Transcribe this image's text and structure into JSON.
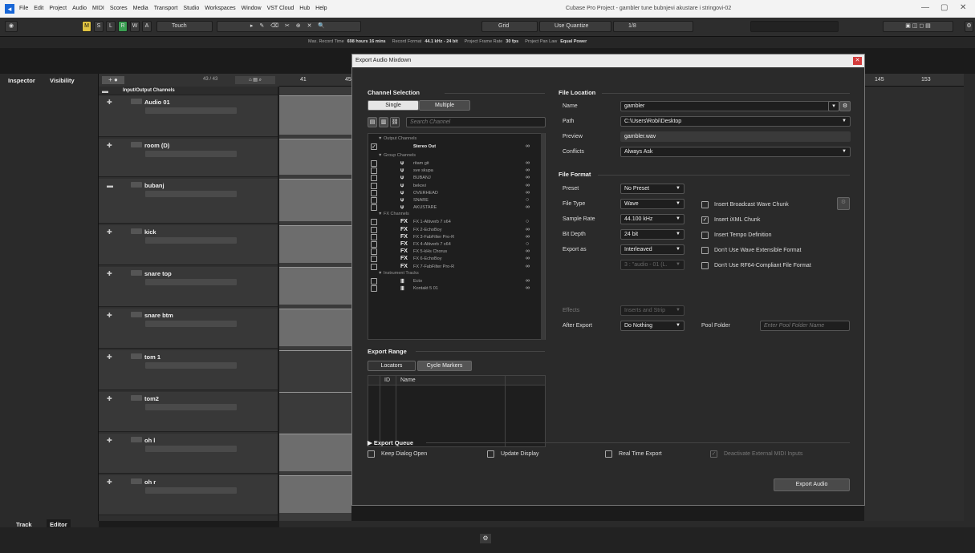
{
  "window": {
    "title": "Cubase Pro Project - gambler tune bubnjevi akustare i stringovi-02",
    "minimize": "—",
    "maximize": "▢",
    "close": "✕"
  },
  "menu": [
    "File",
    "Edit",
    "Project",
    "Audio",
    "MIDI",
    "Scores",
    "Media",
    "Transport",
    "Studio",
    "Workspaces",
    "Window",
    "VST Cloud",
    "Hub",
    "Help"
  ],
  "toolbar": {
    "mode_letters": [
      "M",
      "S",
      "L",
      "R",
      "W",
      "A"
    ],
    "automation_mode": "Touch",
    "grid_label": "Grid",
    "quantize_label": "Use Quantize",
    "quantize_value": "1/8"
  },
  "infobar": [
    {
      "label": "Max. Record Time",
      "value": "698 hours 16 mins"
    },
    {
      "label": "Record Format",
      "value": "44.1 kHz - 24 bit"
    },
    {
      "label": "Project Frame Rate",
      "value": "30 fps"
    },
    {
      "label": "Project Pan Law",
      "value": "Equal Power"
    }
  ],
  "left_tabs": {
    "inspector": "Inspector",
    "visibility": "Visibility",
    "track": "Track",
    "editor": "Editor"
  },
  "tracklist": {
    "counter": "43 / 43",
    "folder": "Input/Output Channels",
    "tracks": [
      "Audio 01",
      "room (D)",
      "bubanj",
      "kick",
      "snare top",
      "snare btm",
      "tom 1",
      "tom2",
      "oh l",
      "oh r"
    ]
  },
  "ruler": {
    "left_marks": [
      "41",
      "45"
    ],
    "right_marks": [
      "145",
      "153"
    ]
  },
  "dialog": {
    "title": "Export Audio Mixdown",
    "channel_selection": {
      "heading": "Channel Selection",
      "tabs": [
        "Single",
        "Multiple"
      ],
      "search_placeholder": "Search Channel",
      "groups": [
        {
          "name": "Output Channels",
          "channels": [
            {
              "name": "Stereo Out",
              "checked": true,
              "type": "∞"
            }
          ]
        },
        {
          "name": "Group Channels",
          "channels": [
            {
              "name": "ritam git",
              "type": "∞"
            },
            {
              "name": "sve skupa",
              "type": "∞"
            },
            {
              "name": "BUBANJ",
              "type": "∞"
            },
            {
              "name": "bekovi",
              "type": "∞"
            },
            {
              "name": "OVERHEAD",
              "type": "∞"
            },
            {
              "name": "SNARE",
              "type": "○"
            },
            {
              "name": "AKUSTARE",
              "type": "∞"
            }
          ]
        },
        {
          "name": "FX Channels",
          "channels": [
            {
              "name": "FX 1-Altiverb 7 x64",
              "type": "○"
            },
            {
              "name": "FX 2-EchoBoy",
              "type": "∞"
            },
            {
              "name": "FX 3-FabFilter Pro-R",
              "type": "∞"
            },
            {
              "name": "FX 4-Altiverb 7 x64",
              "type": "○"
            },
            {
              "name": "FX 5-kHs Chorus",
              "type": "∞"
            },
            {
              "name": "FX 6-EchoBoy",
              "type": "∞"
            },
            {
              "name": "FX 7-FabFilter Pro-R",
              "type": "∞"
            }
          ]
        },
        {
          "name": "Instrument Tracks",
          "channels": [
            {
              "name": "Ecto",
              "type": "∞"
            },
            {
              "name": "Kontakt 5 01",
              "type": "∞"
            }
          ]
        }
      ]
    },
    "export_range": {
      "heading": "Export Range",
      "tabs": [
        "Locators",
        "Cycle Markers"
      ],
      "columns": [
        "ID",
        "Name"
      ]
    },
    "file_location": {
      "heading": "File Location",
      "name_label": "Name",
      "name_value": "gambler",
      "path_label": "Path",
      "path_value": "C:\\Users\\Robi\\Desktop",
      "preview_label": "Preview",
      "preview_value": "gambler.wav",
      "conflicts_label": "Conflicts",
      "conflicts_value": "Always Ask"
    },
    "file_format": {
      "heading": "File Format",
      "preset_label": "Preset",
      "preset_value": "No Preset",
      "filetype_label": "File Type",
      "filetype_value": "Wave",
      "samplerate_label": "Sample Rate",
      "samplerate_value": "44.100 kHz",
      "bitdepth_label": "Bit Depth",
      "bitdepth_value": "24 bit",
      "exportas_label": "Export as",
      "exportas_value": "Interleaved",
      "naming_value": "3 : \"audio - 01 (L.",
      "options": [
        {
          "label": "Insert Broadcast Wave Chunk",
          "checked": false
        },
        {
          "label": "Insert iXML Chunk",
          "checked": true
        },
        {
          "label": "Insert Tempo Definition",
          "checked": false
        },
        {
          "label": "Don't Use Wave Extensible Format",
          "checked": false
        },
        {
          "label": "Don't Use RF64-Compliant File Format",
          "checked": false
        }
      ]
    },
    "effects_label": "Effects",
    "effects_value": "Inserts and Strip",
    "after_export_label": "After Export",
    "after_export_value": "Do Nothing",
    "pool_folder_label": "Pool Folder",
    "pool_folder_placeholder": "Enter Pool Folder Name",
    "export_queue": "Export Queue",
    "bottom_options": [
      {
        "label": "Keep Dialog Open",
        "checked": false
      },
      {
        "label": "Update Display",
        "checked": false
      },
      {
        "label": "Real Time Export",
        "checked": false
      },
      {
        "label": "Deactivate External MIDI Inputs",
        "checked": true,
        "disabled": true
      }
    ],
    "export_button": "Export Audio"
  },
  "colors": {
    "accent": "#e0c341",
    "dialog_bg": "#2a2a2a",
    "clip_gray": "#6d6d6d"
  }
}
